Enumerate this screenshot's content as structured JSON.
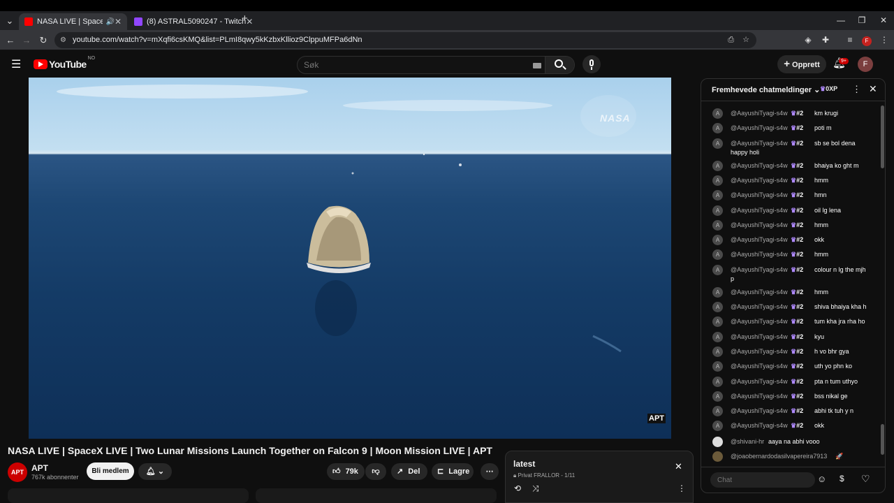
{
  "browser": {
    "tabs": [
      {
        "label": "NASA LIVE | SpaceX LIVE | T",
        "fav": "#ff0000"
      },
      {
        "label": "(8) ASTRAL5090247 - Twitch",
        "fav": "#9146ff"
      }
    ],
    "url": "youtube.com/watch?v=mXqfi6csKMQ&list=PLmI8qwy5kKzbxKllioz9ClppuMFPa6dNn",
    "profile": "F"
  },
  "yt": {
    "logo": "YouTube",
    "region": "NO",
    "search_placeholder": "Søk",
    "create": "Opprett",
    "notif": "9+",
    "avatar": "F"
  },
  "video": {
    "title": "NASA LIVE | SpaceX LIVE | Two Lunar Missions Launch Together on Falcon 9 | Moon Mission LIVE | APT",
    "watermark": "NASA",
    "corner": "APT"
  },
  "channel": {
    "name": "APT",
    "subs": "767k abonnenter",
    "avatar": "APT",
    "join": "Bli medlem"
  },
  "actions": {
    "likes": "79k",
    "share": "Del",
    "save": "Lagre"
  },
  "playlist": {
    "title": "latest",
    "meta": "Privat FRALLOR - 1/11"
  },
  "chat": {
    "title": "Fremhevede chatmeldinger",
    "xp": "0XP",
    "input_placeholder": "Chat",
    "messages": [
      {
        "author": "@AayushiTyagi-s4w",
        "badge": "#2",
        "text": "km krugi"
      },
      {
        "author": "@AayushiTyagi-s4w",
        "badge": "#2",
        "text": "poti m"
      },
      {
        "author": "@AayushiTyagi-s4w",
        "badge": "#2",
        "text": "sb se bol dena",
        "text2": "happy holi"
      },
      {
        "author": "@AayushiTyagi-s4w",
        "badge": "#2",
        "text": "bhaiya ko ght m"
      },
      {
        "author": "@AayushiTyagi-s4w",
        "badge": "#2",
        "text": "hmm"
      },
      {
        "author": "@AayushiTyagi-s4w",
        "badge": "#2",
        "text": "hmn"
      },
      {
        "author": "@AayushiTyagi-s4w",
        "badge": "#2",
        "text": "oil lg lena"
      },
      {
        "author": "@AayushiTyagi-s4w",
        "badge": "#2",
        "text": "hmm"
      },
      {
        "author": "@AayushiTyagi-s4w",
        "badge": "#2",
        "text": "okk"
      },
      {
        "author": "@AayushiTyagi-s4w",
        "badge": "#2",
        "text": "hmm"
      },
      {
        "author": "@AayushiTyagi-s4w",
        "badge": "#2",
        "text": "colour n lg the mjh",
        "text2": "p"
      },
      {
        "author": "@AayushiTyagi-s4w",
        "badge": "#2",
        "text": "hmm"
      },
      {
        "author": "@AayushiTyagi-s4w",
        "badge": "#2",
        "text": "shiva bhaiya kha h"
      },
      {
        "author": "@AayushiTyagi-s4w",
        "badge": "#2",
        "text": "tum kha jra rha ho"
      },
      {
        "author": "@AayushiTyagi-s4w",
        "badge": "#2",
        "text": "kyu"
      },
      {
        "author": "@AayushiTyagi-s4w",
        "badge": "#2",
        "text": "h vo bhr gya"
      },
      {
        "author": "@AayushiTyagi-s4w",
        "badge": "#2",
        "text": "uth yo phn ko"
      },
      {
        "author": "@AayushiTyagi-s4w",
        "badge": "#2",
        "text": "pta n tum uthyo"
      },
      {
        "author": "@AayushiTyagi-s4w",
        "badge": "#2",
        "text": "bss nikal ge"
      },
      {
        "author": "@AayushiTyagi-s4w",
        "badge": "#2",
        "text": "abhi tk tuh y n"
      },
      {
        "author": "@AayushiTyagi-s4w",
        "badge": "#2",
        "text": "okk"
      }
    ],
    "extra": [
      {
        "author": "@shivani-hr",
        "text": "aaya na abhi vooo"
      },
      {
        "author": "@joaobernardodasilvapereira7913",
        "text": "🚀"
      }
    ]
  }
}
